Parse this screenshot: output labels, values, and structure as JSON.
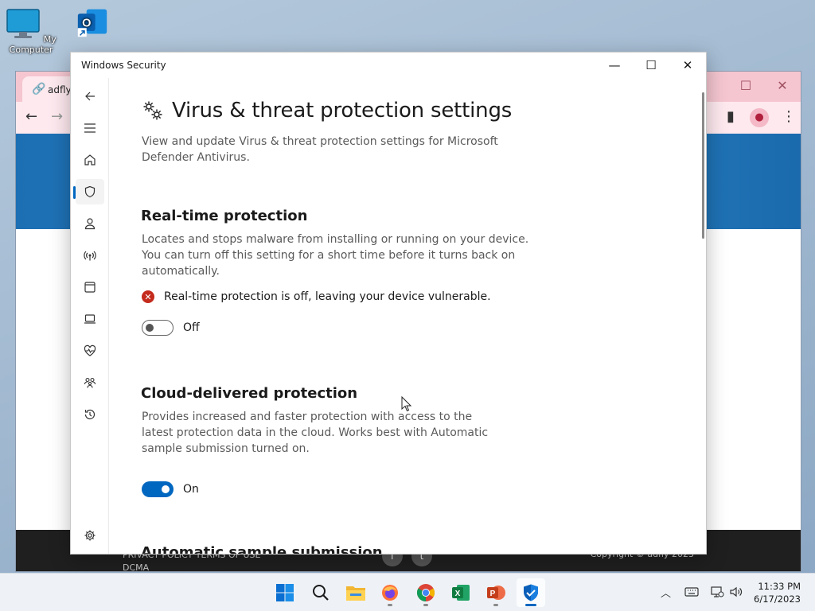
{
  "desktop": {
    "icons": [
      {
        "label": "My Computer",
        "icon": "monitor-icon"
      },
      {
        "label": "Outlook",
        "icon": "outlook-icon"
      }
    ]
  },
  "browser": {
    "tab_title": "adfly",
    "footer_links": "PRIVACY POLICY   TERMS OF USE",
    "footer_links2": "DCMA",
    "copyright": "Copyright © adfly 2023"
  },
  "security_window": {
    "title": "Windows Security",
    "nav_items": [
      {
        "name": "back",
        "icon": "back-arrow-icon"
      },
      {
        "name": "menu",
        "icon": "hamburger-icon"
      },
      {
        "name": "home",
        "icon": "home-icon"
      },
      {
        "name": "virus-protection",
        "icon": "shield-icon",
        "active": true
      },
      {
        "name": "account-protection",
        "icon": "person-icon"
      },
      {
        "name": "firewall",
        "icon": "network-icon"
      },
      {
        "name": "app-browser-control",
        "icon": "browser-window-icon"
      },
      {
        "name": "device-security",
        "icon": "laptop-icon"
      },
      {
        "name": "device-performance",
        "icon": "heart-pulse-icon"
      },
      {
        "name": "family-options",
        "icon": "family-icon"
      },
      {
        "name": "protection-history",
        "icon": "history-icon"
      },
      {
        "name": "settings",
        "icon": "gear-icon"
      }
    ],
    "page_title": "Virus & threat protection settings",
    "page_desc": "View and update Virus & threat protection settings for Microsoft Defender Antivirus.",
    "realtime": {
      "heading": "Real-time protection",
      "desc": "Locates and stops malware from installing or running on your device. You can turn off this setting for a short time before it turns back on automatically.",
      "warning": "Real-time protection is off, leaving your device vulnerable.",
      "toggle_label": "Off",
      "enabled": false
    },
    "cloud": {
      "heading": "Cloud-delivered protection",
      "desc": "Provides increased and faster protection with access to the latest protection data in the cloud. Works best with Automatic sample submission turned on.",
      "toggle_label": "On",
      "enabled": true
    },
    "next_heading": "Automatic sample submission"
  },
  "taskbar": {
    "apps": [
      {
        "name": "start",
        "icon": "windows-logo-icon"
      },
      {
        "name": "search",
        "icon": "search-icon"
      },
      {
        "name": "file-explorer",
        "icon": "folder-icon"
      },
      {
        "name": "firefox",
        "icon": "firefox-icon"
      },
      {
        "name": "chrome",
        "icon": "chrome-icon"
      },
      {
        "name": "excel",
        "icon": "excel-icon"
      },
      {
        "name": "powerpoint",
        "icon": "powerpoint-icon"
      },
      {
        "name": "windows-security",
        "icon": "shield-icon",
        "active": true
      }
    ],
    "time": "11:33 PM",
    "date": "6/17/2023"
  },
  "colors": {
    "accent": "#0067c0",
    "error": "#c42b1c"
  }
}
